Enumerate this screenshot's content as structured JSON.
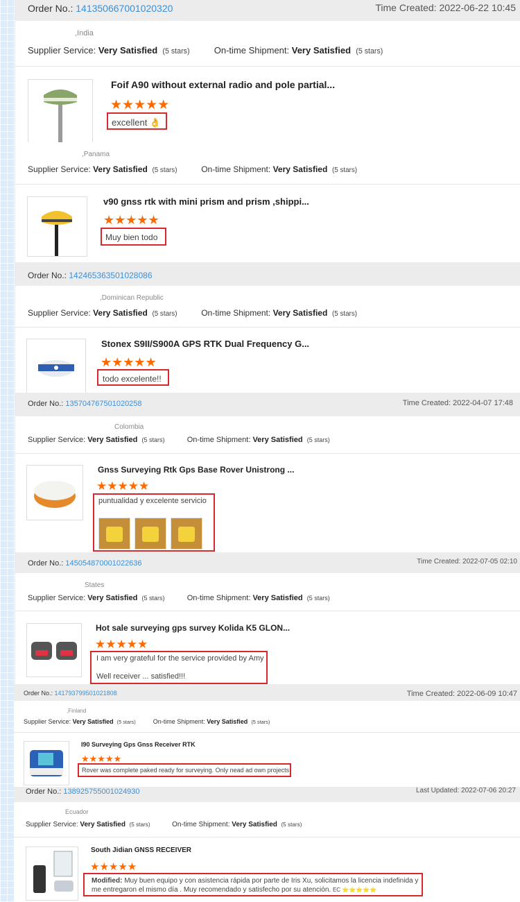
{
  "labels": {
    "order_no": "Order No.:",
    "time_created": "Time Created:",
    "last_updated": "Last Updated:",
    "supplier_service": "Supplier Service:",
    "ontime_shipment": "On-time Shipment:",
    "very_satisfied": "Very Satisfied",
    "five_stars": "(5 stars)",
    "stars": "★★★★★"
  },
  "reviews": [
    {
      "order_no": "141350667001020320",
      "time": "2022-06-22 10:45",
      "country": ",India",
      "title": "Foif A90 without external radio and pole partial...",
      "review": "excellent 👌"
    },
    {
      "order_no": "",
      "time": "",
      "country": ",Panama",
      "title": "v90 gnss rtk with mini prism and prism ,shippi...",
      "review": "Muy bien todo"
    },
    {
      "order_no": "142465363501028086",
      "time": "",
      "country": ",Dominican Republic",
      "title": "Stonex S9II/S900A GPS RTK Dual Frequency G...",
      "review": "todo excelente!!"
    },
    {
      "order_no": "135704767501020258",
      "time": "2022-04-07 17:48",
      "country": "Colombia",
      "title": "Gnss Surveying Rtk Gps Base Rover Unistrong ...",
      "review": "puntualidad y excelente servicio"
    },
    {
      "order_no": "145054870001022636",
      "time": "2022-07-05 02:10",
      "country": "States",
      "title": "Hot sale surveying gps survey Kolida K5 GLON...",
      "review": "I am very grateful for the service provided by Amy",
      "review2": "Well receiver ... satisfied!!!"
    },
    {
      "order_no": "141793799501021808",
      "time": "2022-06-09 10:47",
      "country": ",Finland",
      "title": "I90 Surveying Gps Gnss Receiver RTK",
      "review": "Rover was complete paked ready for surveying. Only nead ad own projects"
    },
    {
      "order_no": "138925755001024930",
      "time": "2022-07-06 20:27",
      "country": "Ecuador",
      "title": "South Jidian GNSS RECEIVER",
      "review_prefix": "Modified:",
      "review": "Muy buen equipo y con asistencia rápida por parte de Iris Xu, solicitamos la licencia indefinida y me entregaron el mismo día . Muy recomendado y satisfecho por su atención.",
      "review_suffix": "EC ⭐⭐⭐⭐⭐"
    }
  ],
  "colors": {
    "accent_link": "#3d8fd6",
    "stars": "#ff6a00",
    "highlight_border": "#d8282e",
    "header_bar": "#ececec"
  }
}
